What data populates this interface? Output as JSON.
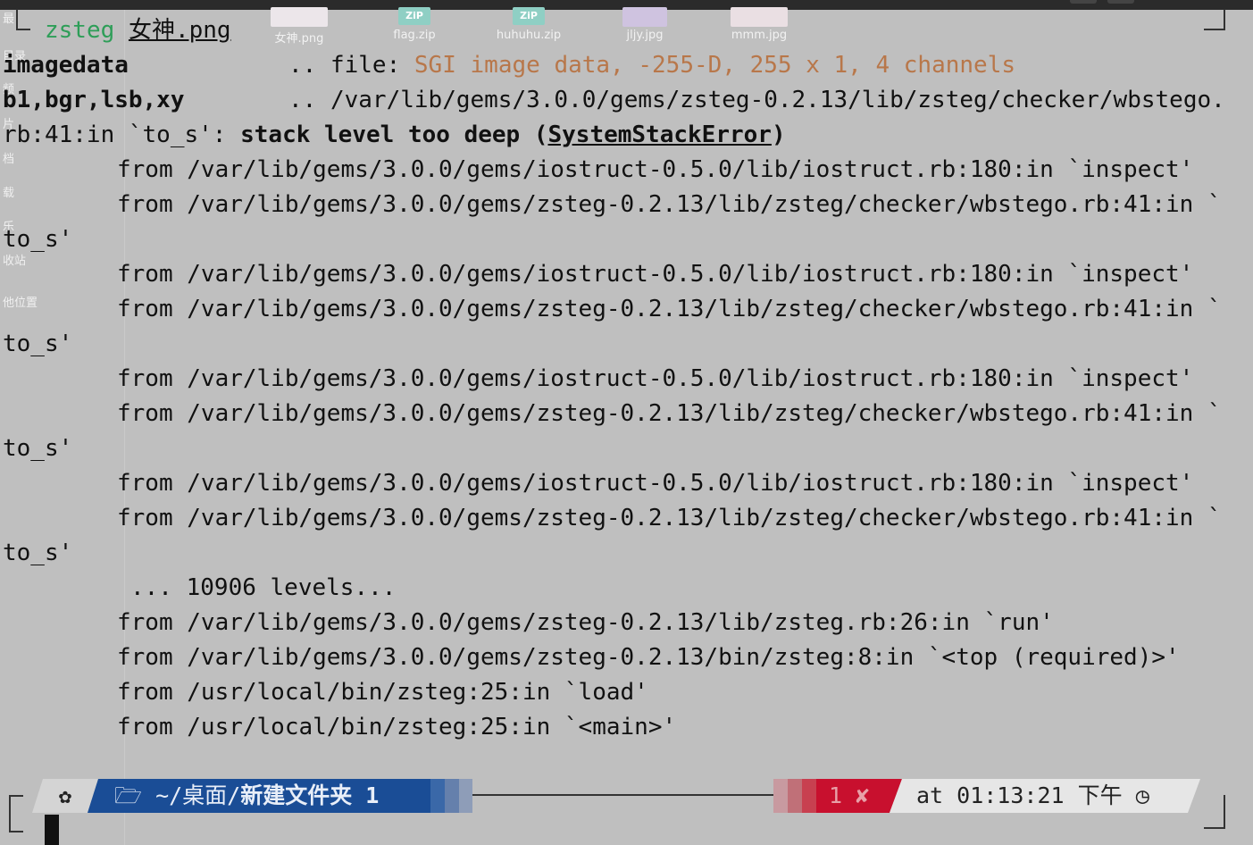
{
  "desktop": {
    "files": [
      {
        "name": "女神.png",
        "type": "image"
      },
      {
        "name": "flag.zip",
        "type": "zip"
      },
      {
        "name": "huhuhu.zip",
        "type": "zip"
      },
      {
        "name": "jljy.jpg",
        "type": "image"
      },
      {
        "name": "mmm.jpg",
        "type": "image"
      }
    ],
    "zip_badge": "ZiP",
    "sidebar_fragments": [
      "最",
      "目录",
      "频",
      "片",
      "档",
      "载",
      "乐",
      "收站",
      "他位置"
    ]
  },
  "terminal": {
    "prompt_cmd": "zsteg",
    "prompt_arg": "女神.png",
    "line1": {
      "key": "imagedata",
      "sep": "..",
      "label": "file:",
      "value": "SGI image data, -255-D, 255 x 1, 4 channels"
    },
    "line2": {
      "key": "b1,bgr,lsb,xy",
      "sep": "..",
      "value": "/var/lib/gems/3.0.0/gems/zsteg-0.2.13/lib/zsteg/checker/wbstego."
    },
    "line3": {
      "prefix": "rb:41:in `to_s': ",
      "msg": "stack level too deep (",
      "err": "SystemStackError",
      "close": ")"
    },
    "trace_a": "from /var/lib/gems/3.0.0/gems/iostruct-0.5.0/lib/iostruct.rb:180:in `inspect'",
    "trace_b": "from /var/lib/gems/3.0.0/gems/zsteg-0.2.13/lib/zsteg/checker/wbstego.rb:41:in `",
    "trace_b_wrap": "to_s'",
    "levels": "... 10906 levels...",
    "tail": [
      "from /var/lib/gems/3.0.0/gems/zsteg-0.2.13/lib/zsteg.rb:26:in `run'",
      "from /var/lib/gems/3.0.0/gems/zsteg-0.2.13/bin/zsteg:8:in `<top (required)>'",
      "from /usr/local/bin/zsteg:25:in `load'",
      "from /usr/local/bin/zsteg:25:in `<main>'"
    ]
  },
  "statusline": {
    "os_icon": "ubuntu-icon",
    "folder_icon": "🗁",
    "path_prefix": "~/桌面/",
    "path_bold": "新建文件夹 1",
    "exit_code": "1",
    "exit_mark": "✘",
    "time_text": "at 01:13:21 下午",
    "clock_icon": "◷"
  },
  "colors": {
    "cmd_green": "#2e9e58",
    "file_orange": "#b8774a",
    "path_bg": "#1a4d96",
    "error_bg": "#c8102e",
    "time_bg": "#e6e6e6"
  }
}
